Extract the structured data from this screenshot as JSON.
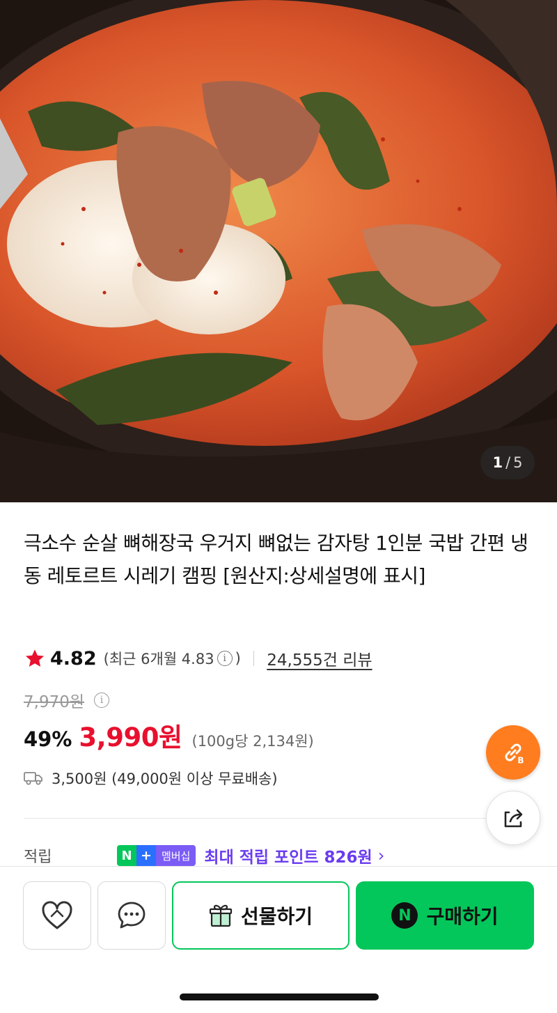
{
  "gallery": {
    "current": "1",
    "separator": "/",
    "total": "5"
  },
  "product": {
    "title": "극소수 순살 뼈해장국 우거지 뼈없는 감자탕 1인분 국밥 간편 냉동 레토르트 시레기 캠핑 [원산지:상세설명에 표시]",
    "rating": "4.82",
    "recent_rating": "(최근 6개월 4.83",
    "recent_close": ")",
    "review_link": "24,555건 리뷰"
  },
  "pricing": {
    "original": "7,970원",
    "discount": "49%",
    "price": "3,990원",
    "unit_price": "(100g당 2,134원)"
  },
  "shipping": {
    "text": "3,500원 (49,000원 이상 무료배송)"
  },
  "points": {
    "label": "적립",
    "badge_n": "N",
    "badge_plus": "+",
    "badge_text": "멤버십",
    "text": "최대 적립 포인트 826원",
    "chevron": "›"
  },
  "actions": {
    "gift_label": "선물하기",
    "buy_label": "구매하기",
    "buy_icon_letter": "N"
  },
  "icons": {
    "star": "star-icon",
    "info": "info-icon",
    "truck": "truck-icon",
    "link": "link-b-icon",
    "share": "share-icon",
    "heart": "heart-icon",
    "talk": "chat-bubble-icon",
    "gift": "gift-icon"
  },
  "colors": {
    "accent_green": "#03c75a",
    "price_red": "#e8102e",
    "points_purple": "#6a3cf0",
    "link_orange": "#ff7d1f"
  }
}
